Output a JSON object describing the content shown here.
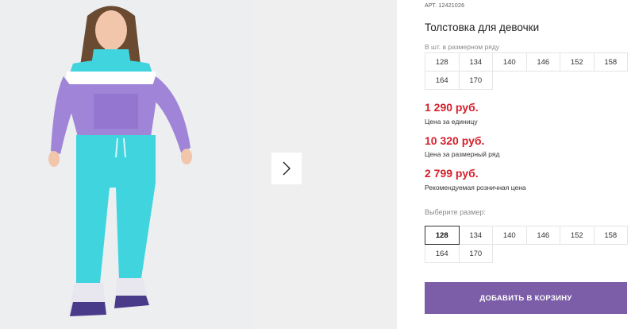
{
  "product": {
    "article_label": "АРТ.",
    "article_number": "12421026",
    "title": "Толстовка для девочки",
    "image_alt": "Девочка в толстовке и брюках"
  },
  "size_row": {
    "hint": "В шт. в размерном ряду",
    "sizes": [
      "128",
      "134",
      "140",
      "146",
      "152",
      "158",
      "164",
      "170"
    ]
  },
  "prices": {
    "unit_price": "1 290 руб.",
    "unit_label": "Цена за единицу",
    "row_price": "10 320 руб.",
    "row_label": "Цена за размерный ряд",
    "retail_price": "2 799 руб.",
    "retail_label": "Рекомендуемая розничная цена"
  },
  "size_select": {
    "label": "Выберите размер:",
    "sizes": [
      "128",
      "134",
      "140",
      "146",
      "152",
      "158",
      "164",
      "170"
    ],
    "selected": "128"
  },
  "actions": {
    "add_to_cart": "ДОБАВИТЬ В КОРЗИНУ",
    "next_icon": "chevron-right-icon"
  },
  "colors": {
    "price_red": "#d51f2c",
    "button_purple": "#7b5ea7"
  }
}
